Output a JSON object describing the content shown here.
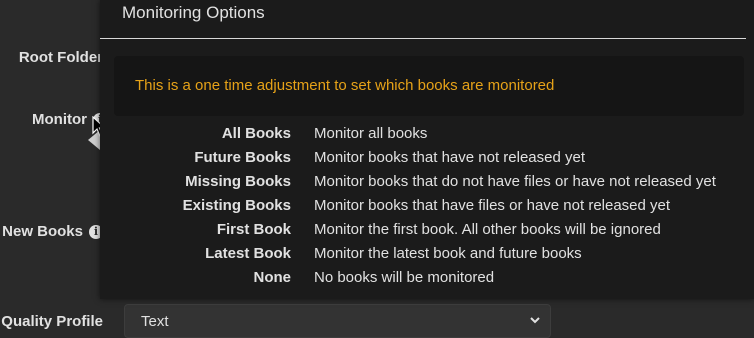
{
  "form": {
    "root_folder_label": "Root Folder",
    "monitor_label": "Monitor",
    "new_books_label": "New Books",
    "quality_profile_label": "Quality Profile",
    "quality_profile_value": "Text"
  },
  "popover": {
    "title": "Monitoring Options",
    "alert": "This is a one time adjustment to set which books are monitored",
    "options": [
      {
        "name": "All Books",
        "description": "Monitor all books"
      },
      {
        "name": "Future Books",
        "description": "Monitor books that have not released yet"
      },
      {
        "name": "Missing Books",
        "description": "Monitor books that do not have files or have not released yet"
      },
      {
        "name": "Existing Books",
        "description": "Monitor books that have files or have not released yet"
      },
      {
        "name": "First Book",
        "description": "Monitor the first book. All other books will be ignored"
      },
      {
        "name": "Latest Book",
        "description": "Monitor the latest book and future books"
      },
      {
        "name": "None",
        "description": "No books will be monitored"
      }
    ]
  },
  "icons": {
    "info": "info-icon",
    "chevron": "chevron-down-icon",
    "cursor": "mouse-cursor-icon"
  },
  "colors": {
    "alert_text": "#e6a218",
    "popover_bg": "#1b1b1b",
    "page_bg": "#2a2a2a"
  }
}
